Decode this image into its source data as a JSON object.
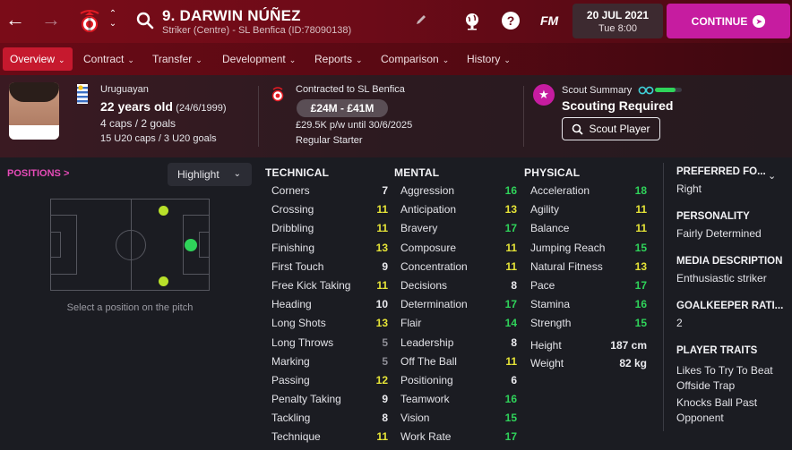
{
  "header": {
    "player_name": "9. DARWIN NÚÑEZ",
    "player_subtitle": "Striker (Centre) - SL Benfica (ID:78090138)",
    "fm_logo": "FM",
    "help_label": "?",
    "date": "20 JUL 2021",
    "time": "Tue 8:00",
    "continue_label": "CONTINUE",
    "icons": [
      "back-arrow-icon",
      "forward-arrow-icon",
      "club-crest-icon",
      "up-down-chevron-icon",
      "search-icon",
      "pencil-icon",
      "world-icon",
      "help-icon"
    ]
  },
  "tabs": [
    {
      "label": "Overview",
      "active": true
    },
    {
      "label": "Contract",
      "active": false
    },
    {
      "label": "Transfer",
      "active": false
    },
    {
      "label": "Development",
      "active": false
    },
    {
      "label": "Reports",
      "active": false
    },
    {
      "label": "Comparison",
      "active": false
    },
    {
      "label": "History",
      "active": false
    }
  ],
  "profile": {
    "nationality": "Uruguayan",
    "age": "22 years old",
    "dob": "(24/6/1999)",
    "caps": "4 caps / 2 goals",
    "u20_caps": "15 U20 caps / 3 U20 goals"
  },
  "contract": {
    "club_line": "Contracted to SL Benfica",
    "value_range": "£24M - £41M",
    "wage": "£29.5K p/w until 30/6/2025",
    "status": "Regular Starter"
  },
  "scout": {
    "label": "Scout Summary",
    "summary": "Scouting Required",
    "button_label": "Scout Player",
    "knowledge_fraction": 0.75
  },
  "positions": {
    "title": "POSITIONS",
    "title_arrow": ">",
    "highlight_label": "Highlight",
    "caption": "Select a position on the pitch"
  },
  "attributes": {
    "technical": {
      "title": "TECHNICAL",
      "rows": [
        {
          "name": "Corners",
          "value": "7"
        },
        {
          "name": "Crossing",
          "value": "11"
        },
        {
          "name": "Dribbling",
          "value": "11"
        },
        {
          "name": "Finishing",
          "value": "13"
        },
        {
          "name": "First Touch",
          "value": "9"
        },
        {
          "name": "Free Kick Taking",
          "value": "11"
        },
        {
          "name": "Heading",
          "value": "10"
        },
        {
          "name": "Long Shots",
          "value": "13"
        },
        {
          "name": "Long Throws",
          "value": "5"
        },
        {
          "name": "Marking",
          "value": "5"
        },
        {
          "name": "Passing",
          "value": "12"
        },
        {
          "name": "Penalty Taking",
          "value": "9"
        },
        {
          "name": "Tackling",
          "value": "8"
        },
        {
          "name": "Technique",
          "value": "11"
        }
      ]
    },
    "mental": {
      "title": "MENTAL",
      "rows": [
        {
          "name": "Aggression",
          "value": "16"
        },
        {
          "name": "Anticipation",
          "value": "13"
        },
        {
          "name": "Bravery",
          "value": "17"
        },
        {
          "name": "Composure",
          "value": "11"
        },
        {
          "name": "Concentration",
          "value": "11"
        },
        {
          "name": "Decisions",
          "value": "8"
        },
        {
          "name": "Determination",
          "value": "17"
        },
        {
          "name": "Flair",
          "value": "14"
        },
        {
          "name": "Leadership",
          "value": "8"
        },
        {
          "name": "Off The Ball",
          "value": "11"
        },
        {
          "name": "Positioning",
          "value": "6"
        },
        {
          "name": "Teamwork",
          "value": "16"
        },
        {
          "name": "Vision",
          "value": "15"
        },
        {
          "name": "Work Rate",
          "value": "17"
        }
      ]
    },
    "physical": {
      "title": "PHYSICAL",
      "rows": [
        {
          "name": "Acceleration",
          "value": "18"
        },
        {
          "name": "Agility",
          "value": "11"
        },
        {
          "name": "Balance",
          "value": "11"
        },
        {
          "name": "Jumping Reach",
          "value": "15"
        },
        {
          "name": "Natural Fitness",
          "value": "13"
        },
        {
          "name": "Pace",
          "value": "17"
        },
        {
          "name": "Stamina",
          "value": "16"
        },
        {
          "name": "Strength",
          "value": "15"
        }
      ],
      "height_label": "Height",
      "height": "187 cm",
      "weight_label": "Weight",
      "weight": "82 kg"
    }
  },
  "right_panel": {
    "preferred_foot_title": "PREFERRED FO...",
    "preferred_foot": "Right",
    "personality_title": "PERSONALITY",
    "personality": "Fairly Determined",
    "media_title": "MEDIA DESCRIPTION",
    "media": "Enthusiastic striker",
    "gk_title": "GOALKEEPER RATI...",
    "gk": "2",
    "traits_title": "PLAYER TRAITS",
    "traits": [
      "Likes To Try To Beat Offside Trap",
      "Knocks Ball Past Opponent"
    ]
  },
  "colors": {
    "accent": "#c61ca0",
    "tab_active": "#c6192e",
    "attr_high": "#2fd35a",
    "attr_mid": "#e6e437",
    "attr_low": "#8d8d95"
  }
}
